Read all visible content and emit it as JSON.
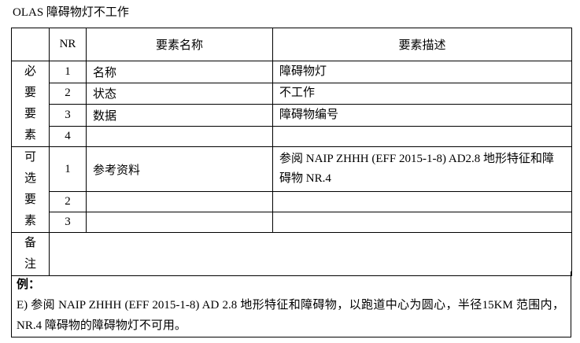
{
  "title": "OLAS  障碍物灯不工作",
  "header": {
    "nr": "NR",
    "name": "要素名称",
    "desc": "要素描述"
  },
  "groups": {
    "mandatory": [
      "必",
      "要",
      "要",
      "素"
    ],
    "optional": [
      "可",
      "选",
      "要",
      "素"
    ],
    "note": [
      "备",
      "注"
    ]
  },
  "mandatory_rows": [
    {
      "nr": "1",
      "name": "名称",
      "desc": "障碍物灯"
    },
    {
      "nr": "2",
      "name": "状态",
      "desc": "不工作"
    },
    {
      "nr": "3",
      "name": "数据",
      "desc": "障碍物编号"
    },
    {
      "nr": "4",
      "name": "",
      "desc": ""
    }
  ],
  "optional_rows": [
    {
      "nr": "1",
      "name": "参考资料",
      "desc": "参阅  NAIP  ZHHH  (EFF  2015-1-8)  AD2.8  地形特征和障碍物   NR.4"
    },
    {
      "nr": "2",
      "name": "",
      "desc": ""
    },
    {
      "nr": "3",
      "name": "",
      "desc": ""
    }
  ],
  "example": {
    "label": "例：",
    "text": "E)  参阅 NAIP ZHHH (EFF 2015-1-8) AD 2.8 地形特征和障碍物，以跑道中心为圆心，半径15KM  范围内，NR.4 障碍物的障碍物灯不可用。"
  }
}
